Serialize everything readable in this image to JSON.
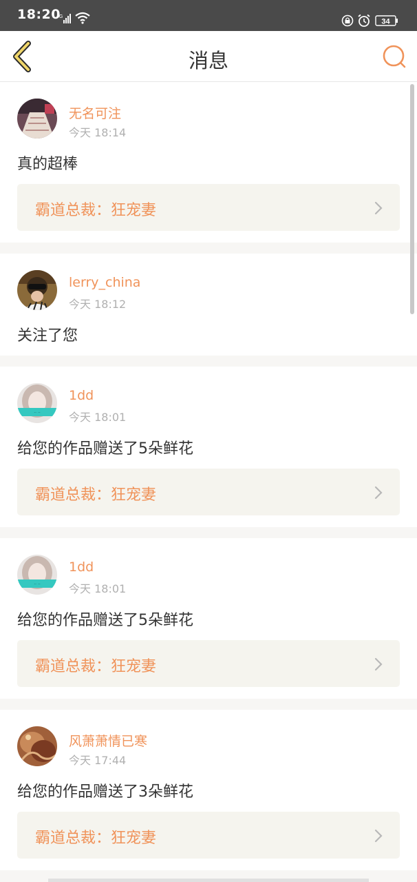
{
  "status_bar": {
    "time": "18:20",
    "network": "4G",
    "battery": "34"
  },
  "nav": {
    "title": "消息",
    "back_icon": "chevron-left-icon",
    "search_icon": "search-icon",
    "accent_color": "#f0935a"
  },
  "messages": [
    {
      "user": "无名可注",
      "time": "今天 18:14",
      "text": "真的超棒",
      "work": "霸道总裁：狂宠妻"
    },
    {
      "user": "lerry_china",
      "time": "今天 18:12",
      "text": "关注了您"
    },
    {
      "user": "1dd",
      "time": "今天 18:01",
      "text": "给您的作品赠送了5朵鲜花",
      "work": "霸道总裁：狂宠妻"
    },
    {
      "user": "1dd",
      "time": "今天 18:01",
      "text": "给您的作品赠送了5朵鲜花",
      "work": "霸道总裁：狂宠妻"
    },
    {
      "user": "风萧萧情已寒",
      "time": "今天 17:44",
      "text": "给您的作品赠送了3朵鲜花",
      "work": "霸道总裁：狂宠妻"
    }
  ]
}
